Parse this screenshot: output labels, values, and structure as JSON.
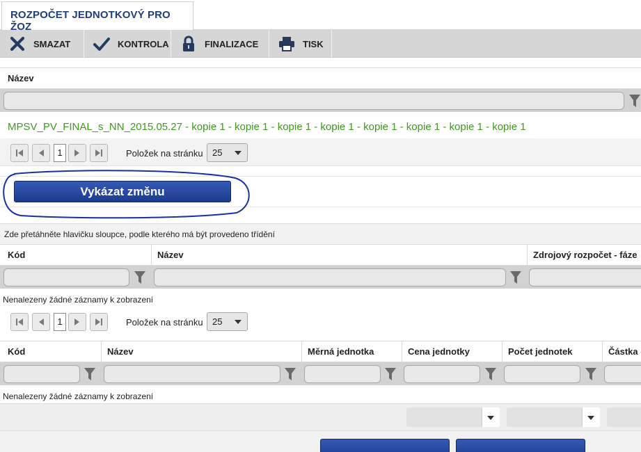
{
  "tab": {
    "label": "ROZPOČET JEDNOTKOVÝ PRO ŽOZ"
  },
  "toolbar": {
    "delete": "SMAZAT",
    "check": "KONTROLA",
    "finalize": "FINALIZACE",
    "print": "TISK"
  },
  "grid1": {
    "col_name": "Název",
    "row_value": "MPSV_PV_FINAL_s_NN_2015.05.27 - kopie 1 - kopie 1 - kopie 1 - kopie 1 - kopie 1 - kopie 1 - kopie 1 - kopie 1",
    "pager": {
      "page": "1",
      "per_page_label": "Položek na stránku",
      "per_page": "25"
    }
  },
  "action": {
    "report_change": "Vykázat změnu"
  },
  "grid2": {
    "group_hint": "Zde přetáhněte hlavičku sloupce, podle kterého má být provedeno třídění",
    "col_code": "Kód",
    "col_name": "Název",
    "col_source": "Zdrojový rozpočet - fáze",
    "empty": "Nenalezeny žádné záznamy k zobrazení",
    "pager": {
      "page": "1",
      "per_page_label": "Položek na stránku",
      "per_page": "25"
    }
  },
  "grid3": {
    "col_code": "Kód",
    "col_name": "Název",
    "col_unit": "Měrná jednotka",
    "col_unit_price": "Cena jednotky",
    "col_unit_count": "Počet jednotek",
    "col_amount": "Částka c",
    "empty": "Nenalezeny žádné záznamy k zobrazení"
  },
  "colors": {
    "accent": "#1f3f7a",
    "green_text": "#3f9a1e",
    "button": "#1d3b8e",
    "annotation": "#1b2fa8"
  }
}
